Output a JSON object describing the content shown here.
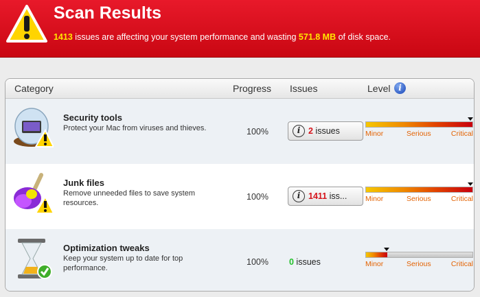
{
  "header": {
    "title": "Scan Results",
    "issues_count": "1413",
    "issues_text": " issues are affecting your system performance and wasting ",
    "space": "571.8 MB",
    "space_text": " of disk space."
  },
  "table": {
    "columns": {
      "category": "Category",
      "progress": "Progress",
      "issues": "Issues",
      "level": "Level"
    },
    "level_labels": {
      "minor": "Minor",
      "serious": "Serious",
      "critical": "Critical"
    },
    "rows": [
      {
        "title": "Security tools",
        "desc": "Protect your Mac from viruses and thieves.",
        "progress": "100%",
        "issue_count": "2",
        "issue_suffix": " issues",
        "level": 1.0,
        "icon": "security-tools-icon"
      },
      {
        "title": "Junk files",
        "desc": "Remove unneeded files to save system resources.",
        "progress": "100%",
        "issue_count": "1411",
        "issue_suffix": " iss...",
        "level": 1.0,
        "icon": "junk-files-icon"
      },
      {
        "title": "Optimization tweaks",
        "desc": "Keep your system up to date for top performance.",
        "progress": "100%",
        "issue_count": "0",
        "issue_suffix": " issues",
        "level": 0.2,
        "icon": "optimization-icon"
      }
    ]
  },
  "colors": {
    "banner": "#d50e1b",
    "highlight": "#ffe600",
    "issue_red": "#d6141c",
    "issue_green": "#22c02a"
  }
}
